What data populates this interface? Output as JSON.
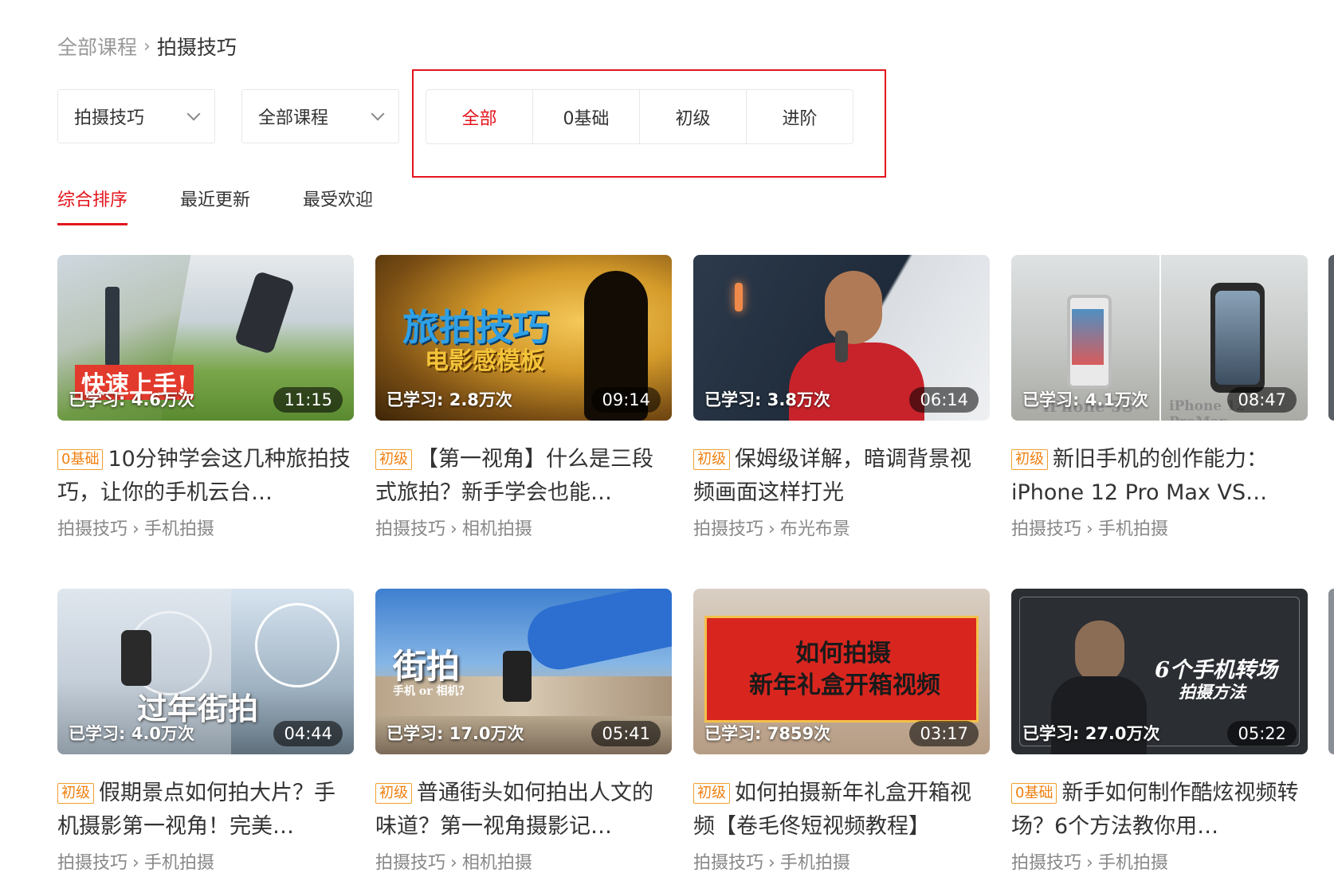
{
  "breadcrumb": {
    "root": "全部课程",
    "current": "拍摄技巧"
  },
  "filters": {
    "category_select": "拍摄技巧",
    "course_select": "全部课程"
  },
  "level_tabs": [
    "全部",
    "0基础",
    "初级",
    "进阶"
  ],
  "level_active": "全部",
  "sort_tabs": [
    "综合排序",
    "最近更新",
    "最受欢迎"
  ],
  "sort_active": "综合排序",
  "colors": {
    "accent": "#e4151d",
    "badge": "#f08010"
  },
  "cards": [
    {
      "level": "0基础",
      "title": "10分钟学会这几种旅拍技巧，让你的手机云台…",
      "learned": "已学习: 4.6万次",
      "duration": "11:15",
      "cat1": "拍摄技巧",
      "cat2": "手机拍摄",
      "overlay": "快速上手!"
    },
    {
      "level": "初级",
      "title": "【第一视角】什么是三段式旅拍？新手学会也能…",
      "learned": "已学习: 2.8万次",
      "duration": "09:14",
      "cat1": "拍摄技巧",
      "cat2": "相机拍摄",
      "overlay": "旅拍技巧",
      "overlay2": "电影感模板"
    },
    {
      "level": "初级",
      "title": "保姆级详解，暗调背景视频画面这样打光",
      "learned": "已学习: 3.8万次",
      "duration": "06:14",
      "cat1": "拍摄技巧",
      "cat2": "布光布景"
    },
    {
      "level": "初级",
      "title": "新旧手机的创作能力：iPhone 12 Pro Max VS…",
      "learned": "已学习: 4.1万次",
      "duration": "08:47",
      "cat1": "拍摄技巧",
      "cat2": "手机拍摄",
      "overlay": "iPhone 5S",
      "overlay2": "iPhone 12 ProMax"
    },
    {
      "level": "初级",
      "title": "假期景点如何拍大片？手机摄影第一视角！完美…",
      "learned": "已学习: 4.0万次",
      "duration": "04:44",
      "cat1": "拍摄技巧",
      "cat2": "手机拍摄",
      "overlay": "过年街拍"
    },
    {
      "level": "初级",
      "title": "普通街头如何拍出人文的味道？第一视角摄影记…",
      "learned": "已学习: 17.0万次",
      "duration": "05:41",
      "cat1": "拍摄技巧",
      "cat2": "相机拍摄",
      "overlay": "街拍",
      "overlay2": "手机 or 相机？"
    },
    {
      "level": "初级",
      "title": "如何拍摄新年礼盒开箱视频【卷毛佟短视频教程】",
      "learned": "已学习: 7859次",
      "duration": "03:17",
      "cat1": "拍摄技巧",
      "cat2": "手机拍摄",
      "overlay": "如何拍摄",
      "overlay2": "新年礼盒开箱视频"
    },
    {
      "level": "0基础",
      "title": "新手如何制作酷炫视频转场？6个方法教你用…",
      "learned": "已学习: 27.0万次",
      "duration": "05:22",
      "cat1": "拍摄技巧",
      "cat2": "手机拍摄",
      "overlay": "6个手机转场",
      "overlay2": "拍摄方法"
    }
  ]
}
